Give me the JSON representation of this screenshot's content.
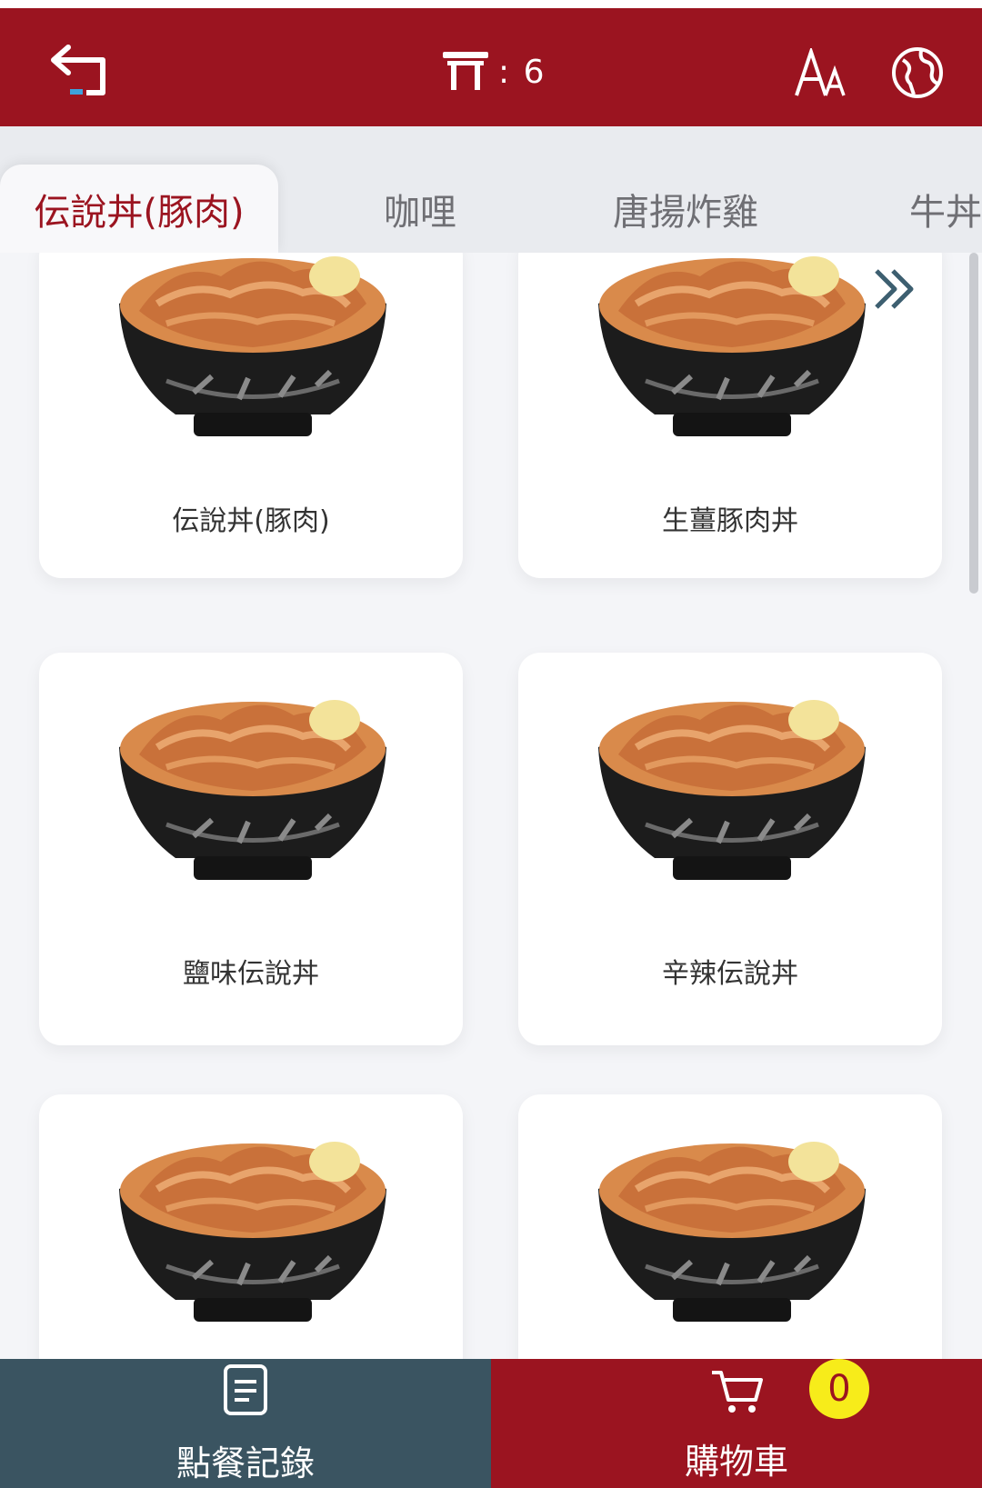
{
  "header": {
    "table_label": ": 6",
    "icons": [
      "back-arrow-icon",
      "table-icon",
      "font-size-icon",
      "globe-icon"
    ]
  },
  "tabs": [
    {
      "label": "伝說丼(豚肉)",
      "active": true
    },
    {
      "label": "咖哩",
      "active": false
    },
    {
      "label": "唐揚炸雞",
      "active": false
    },
    {
      "label": "牛丼",
      "active": false
    }
  ],
  "menu_items": [
    {
      "name": "伝說丼(豚肉)"
    },
    {
      "name": "生薑豚肉丼"
    },
    {
      "name": "鹽味伝說丼"
    },
    {
      "name": "辛辣伝說丼"
    },
    {
      "name": ""
    },
    {
      "name": ""
    }
  ],
  "bottom_bar": {
    "order_history_label": "點餐記錄",
    "cart_label": "購物車",
    "cart_count": "0"
  },
  "colors": {
    "brand_red": "#9b1420",
    "order_bar": "#3a5461",
    "badge_yellow": "#f7ec1a"
  }
}
